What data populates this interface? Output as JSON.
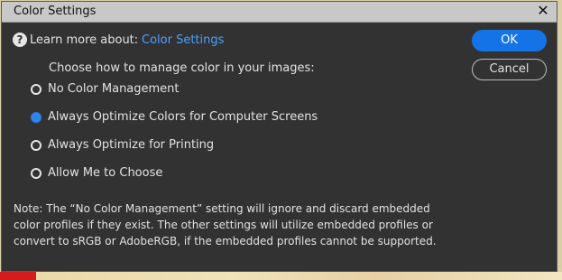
{
  "window": {
    "title": "Color Settings",
    "close_icon": "close-icon"
  },
  "help": {
    "icon": "question-circle-icon",
    "learn_label": "Learn more about:",
    "link_text": "Color Settings",
    "link_color": "#4ba0ff"
  },
  "buttons": {
    "ok_label": "OK",
    "cancel_label": "Cancel",
    "accent": "#1473e6"
  },
  "prompt": "Choose how to manage color in your images:",
  "options": [
    {
      "label": "No Color Management",
      "selected": false
    },
    {
      "label": "Always Optimize Colors for Computer Screens",
      "selected": true
    },
    {
      "label": "Always Optimize for Printing",
      "selected": false
    },
    {
      "label": "Allow Me to Choose",
      "selected": false
    }
  ],
  "note": {
    "lines": [
      "Note: The “No Color Management” setting will ignore and discard embedded",
      "color profiles if they exist. The other settings will utilize embedded profiles or",
      "convert to sRGB or AdobeRGB, if the embedded profiles cannot be supported."
    ]
  }
}
